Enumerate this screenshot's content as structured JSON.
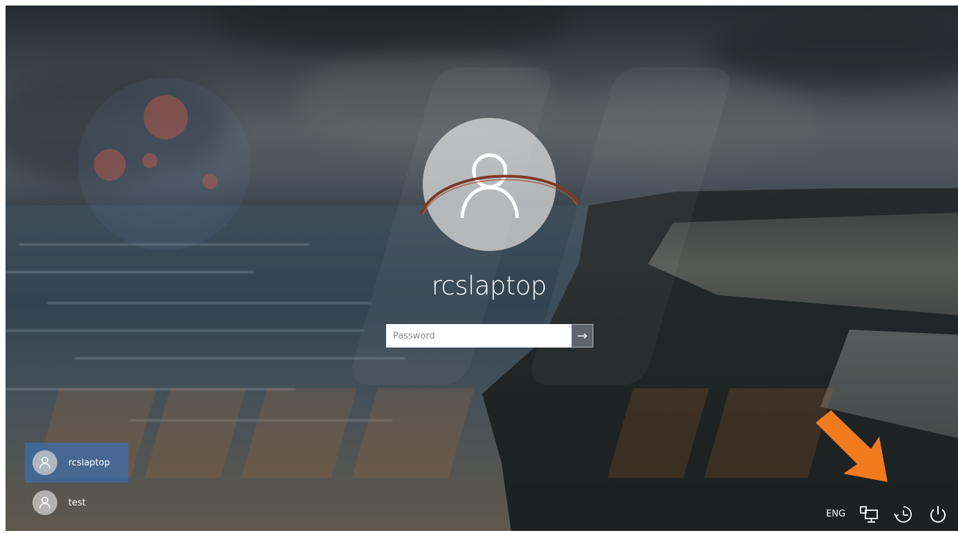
{
  "login": {
    "username": "rcslaptop",
    "password_placeholder": "Password",
    "submit_icon": "arrow-right-icon"
  },
  "user_list": [
    {
      "name": "rcslaptop",
      "selected": true
    },
    {
      "name": "test",
      "selected": false
    }
  ],
  "tray": {
    "language": "ENG",
    "icons": [
      "network-icon",
      "ease-of-access-icon",
      "power-icon"
    ]
  },
  "annotation": {
    "arrow_color": "#f07a1e"
  },
  "colors": {
    "selected_user_bg": "#3c6eaa",
    "text": "#ffffff"
  }
}
